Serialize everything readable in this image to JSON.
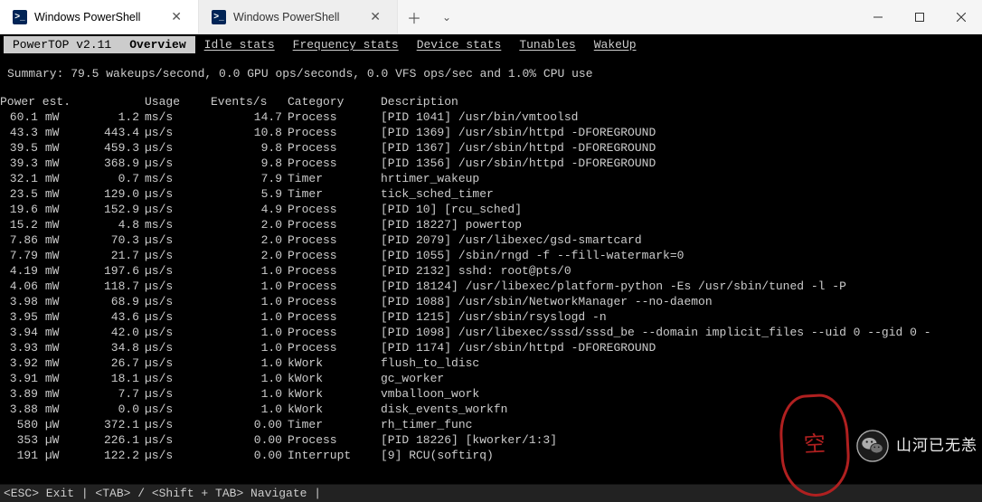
{
  "window": {
    "tabs": [
      {
        "label": "Windows PowerShell",
        "active": true
      },
      {
        "label": "Windows PowerShell",
        "active": false
      }
    ]
  },
  "powertop": {
    "version": "PowerTOP v2.11",
    "menu": [
      "Overview",
      "Idle stats",
      "Frequency stats",
      "Device stats",
      "Tunables",
      "WakeUp"
    ],
    "active_menu": "Overview",
    "summary": "Summary: 79.5 wakeups/second,  0.0 GPU ops/seconds, 0.0 VFS ops/sec and 1.0% CPU use",
    "headers": {
      "power": "Power est.",
      "usage": "Usage",
      "events": "Events/s",
      "category": "Category",
      "description": "Description"
    },
    "rows": [
      {
        "p": "60.1",
        "pu": "mW",
        "u": "1.2",
        "uu": "ms/s",
        "e": "14.7",
        "c": "Process",
        "d": "[PID 1041] /usr/bin/vmtoolsd"
      },
      {
        "p": "43.3",
        "pu": "mW",
        "u": "443.4",
        "uu": "µs/s",
        "e": "10.8",
        "c": "Process",
        "d": "[PID 1369] /usr/sbin/httpd -DFOREGROUND"
      },
      {
        "p": "39.5",
        "pu": "mW",
        "u": "459.3",
        "uu": "µs/s",
        "e": "9.8",
        "c": "Process",
        "d": "[PID 1367] /usr/sbin/httpd -DFOREGROUND"
      },
      {
        "p": "39.3",
        "pu": "mW",
        "u": "368.9",
        "uu": "µs/s",
        "e": "9.8",
        "c": "Process",
        "d": "[PID 1356] /usr/sbin/httpd -DFOREGROUND"
      },
      {
        "p": "32.1",
        "pu": "mW",
        "u": "0.7",
        "uu": "ms/s",
        "e": "7.9",
        "c": "Timer",
        "d": "hrtimer_wakeup"
      },
      {
        "p": "23.5",
        "pu": "mW",
        "u": "129.0",
        "uu": "µs/s",
        "e": "5.9",
        "c": "Timer",
        "d": "tick_sched_timer"
      },
      {
        "p": "19.6",
        "pu": "mW",
        "u": "152.9",
        "uu": "µs/s",
        "e": "4.9",
        "c": "Process",
        "d": "[PID 10] [rcu_sched]"
      },
      {
        "p": "15.2",
        "pu": "mW",
        "u": "4.8",
        "uu": "ms/s",
        "e": "2.0",
        "c": "Process",
        "d": "[PID 18227] powertop"
      },
      {
        "p": "7.86",
        "pu": "mW",
        "u": "70.3",
        "uu": "µs/s",
        "e": "2.0",
        "c": "Process",
        "d": "[PID 2079] /usr/libexec/gsd-smartcard"
      },
      {
        "p": "7.79",
        "pu": "mW",
        "u": "21.7",
        "uu": "µs/s",
        "e": "2.0",
        "c": "Process",
        "d": "[PID 1055] /sbin/rngd -f --fill-watermark=0"
      },
      {
        "p": "4.19",
        "pu": "mW",
        "u": "197.6",
        "uu": "µs/s",
        "e": "1.0",
        "c": "Process",
        "d": "[PID 2132] sshd: root@pts/0"
      },
      {
        "p": "4.06",
        "pu": "mW",
        "u": "118.7",
        "uu": "µs/s",
        "e": "1.0",
        "c": "Process",
        "d": "[PID 18124] /usr/libexec/platform-python -Es /usr/sbin/tuned -l -P"
      },
      {
        "p": "3.98",
        "pu": "mW",
        "u": "68.9",
        "uu": "µs/s",
        "e": "1.0",
        "c": "Process",
        "d": "[PID 1088] /usr/sbin/NetworkManager --no-daemon"
      },
      {
        "p": "3.95",
        "pu": "mW",
        "u": "43.6",
        "uu": "µs/s",
        "e": "1.0",
        "c": "Process",
        "d": "[PID 1215] /usr/sbin/rsyslogd -n"
      },
      {
        "p": "3.94",
        "pu": "mW",
        "u": "42.0",
        "uu": "µs/s",
        "e": "1.0",
        "c": "Process",
        "d": "[PID 1098] /usr/libexec/sssd/sssd_be --domain implicit_files --uid 0 --gid 0 -"
      },
      {
        "p": "3.93",
        "pu": "mW",
        "u": "34.8",
        "uu": "µs/s",
        "e": "1.0",
        "c": "Process",
        "d": "[PID 1174] /usr/sbin/httpd -DFOREGROUND"
      },
      {
        "p": "3.92",
        "pu": "mW",
        "u": "26.7",
        "uu": "µs/s",
        "e": "1.0",
        "c": "kWork",
        "d": "flush_to_ldisc"
      },
      {
        "p": "3.91",
        "pu": "mW",
        "u": "18.1",
        "uu": "µs/s",
        "e": "1.0",
        "c": "kWork",
        "d": "gc_worker"
      },
      {
        "p": "3.89",
        "pu": "mW",
        "u": "7.7",
        "uu": "µs/s",
        "e": "1.0",
        "c": "kWork",
        "d": "vmballoon_work"
      },
      {
        "p": "3.88",
        "pu": "mW",
        "u": "0.0",
        "uu": "µs/s",
        "e": "1.0",
        "c": "kWork",
        "d": "disk_events_workfn"
      },
      {
        "p": "580",
        "pu": "µW",
        "u": "372.1",
        "uu": "µs/s",
        "e": "0.00",
        "c": "Timer",
        "d": "rh_timer_func"
      },
      {
        "p": "353",
        "pu": "µW",
        "u": "226.1",
        "uu": "µs/s",
        "e": "0.00",
        "c": "Process",
        "d": "[PID 18226] [kworker/1:3]"
      },
      {
        "p": "191",
        "pu": "µW",
        "u": "122.2",
        "uu": "µs/s",
        "e": "0.00",
        "c": "Interrupt",
        "d": "[9] RCU(softirq)"
      }
    ],
    "footer": "<ESC> Exit | <TAB> / <Shift + TAB> Navigate |"
  },
  "watermark": {
    "text": "山河已无恙"
  }
}
